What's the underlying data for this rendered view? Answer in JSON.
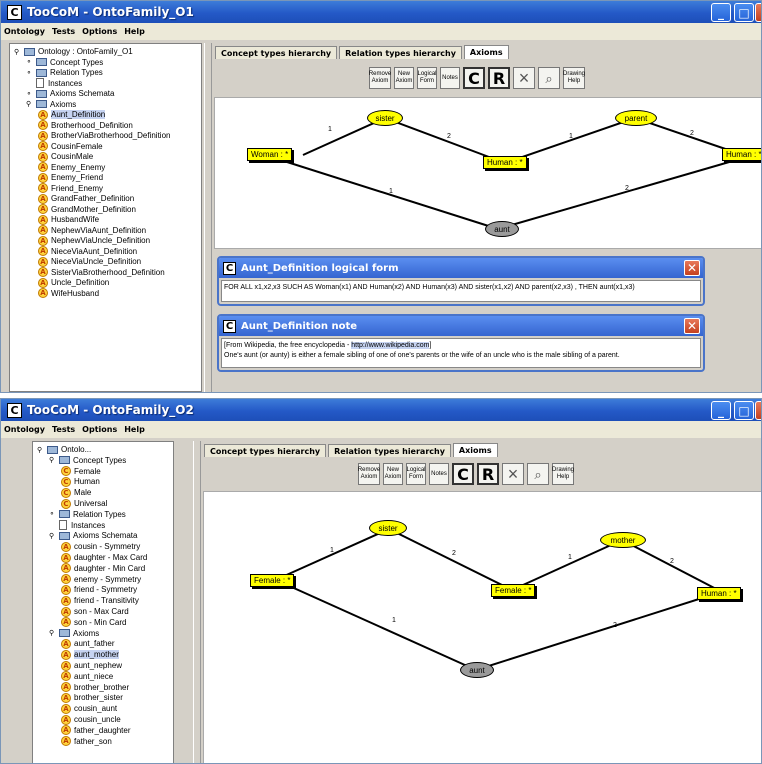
{
  "window1": {
    "title": "TooCoM - OntoFamily_O1",
    "menu": [
      "Ontology",
      "Tests",
      "Options",
      "Help"
    ],
    "tree": [
      {
        "label": "Ontology : OntoFamily_O1",
        "kind": "folder",
        "depth": 0,
        "expanded": true
      },
      {
        "label": "Concept Types",
        "kind": "folder",
        "depth": 1,
        "expanded": false
      },
      {
        "label": "Relation Types",
        "kind": "folder",
        "depth": 1,
        "expanded": false
      },
      {
        "label": "Instances",
        "kind": "doc",
        "depth": 1
      },
      {
        "label": "Axioms Schemata",
        "kind": "folder",
        "depth": 1,
        "expanded": false
      },
      {
        "label": "Axioms",
        "kind": "folder",
        "depth": 1,
        "expanded": true
      },
      {
        "label": "Aunt_Definition",
        "kind": "axiom",
        "depth": 2,
        "selected": true
      },
      {
        "label": "Brotherhood_Definition",
        "kind": "axiom",
        "depth": 2
      },
      {
        "label": "BrotherViaBrotherhood_Definition",
        "kind": "axiom",
        "depth": 2
      },
      {
        "label": "CousinFemale",
        "kind": "axiom",
        "depth": 2
      },
      {
        "label": "CousinMale",
        "kind": "axiom",
        "depth": 2
      },
      {
        "label": "Enemy_Enemy",
        "kind": "axiom",
        "depth": 2
      },
      {
        "label": "Enemy_Friend",
        "kind": "axiom",
        "depth": 2
      },
      {
        "label": "Friend_Enemy",
        "kind": "axiom",
        "depth": 2
      },
      {
        "label": "GrandFather_Definition",
        "kind": "axiom",
        "depth": 2
      },
      {
        "label": "GrandMother_Definition",
        "kind": "axiom",
        "depth": 2
      },
      {
        "label": "HusbandWife",
        "kind": "axiom",
        "depth": 2
      },
      {
        "label": "NephewViaAunt_Definition",
        "kind": "axiom",
        "depth": 2
      },
      {
        "label": "NephewViaUncle_Definition",
        "kind": "axiom",
        "depth": 2
      },
      {
        "label": "NieceViaAunt_Definition",
        "kind": "axiom",
        "depth": 2
      },
      {
        "label": "NieceViaUncle_Definition",
        "kind": "axiom",
        "depth": 2
      },
      {
        "label": "SisterViaBrotherhood_Definition",
        "kind": "axiom",
        "depth": 2
      },
      {
        "label": "Uncle_Definition",
        "kind": "axiom",
        "depth": 2
      },
      {
        "label": "WifeHusband",
        "kind": "axiom",
        "depth": 2
      }
    ],
    "tabs": [
      "Concept types hierarchy",
      "Relation types hierarchy",
      "Axioms"
    ],
    "toolbar": [
      "Remove Axiom",
      "New Axiom",
      "Logical Form",
      "Notes",
      "C",
      "R",
      "×",
      "select",
      "Drawing Help"
    ],
    "graph": {
      "concepts": [
        "Woman : *",
        "Human : *",
        "Human : *"
      ],
      "relations": [
        "sister",
        "parent",
        "aunt"
      ],
      "edge_labels": [
        "1",
        "2",
        "1",
        "2",
        "1",
        "2"
      ]
    },
    "logical_form": {
      "title": "Aunt_Definition logical form",
      "text": "FOR ALL x1,x2,x3 SUCH AS Woman(x1) AND Human(x2) AND Human(x3) AND sister(x1,x2) AND parent(x2,x3)  , THEN aunt(x1,x3)"
    },
    "note": {
      "title": "Aunt_Definition note",
      "line1_prefix": "[From Wikipedia, the free encyclopedia - ",
      "line1_link": "http://www.wikipedia.com",
      "line1_suffix": "]",
      "line2": "One's aunt (or aunty) is either a female sibling of one of one's parents or the wife of an uncle who is the male sibling of a parent."
    }
  },
  "window2": {
    "title": "TooCoM - OntoFamily_O2",
    "menu": [
      "Ontology",
      "Tests",
      "Options",
      "Help"
    ],
    "tree": [
      {
        "label": "Ontolo...",
        "kind": "folder",
        "depth": 0,
        "expanded": true
      },
      {
        "label": "Concept Types",
        "kind": "folder",
        "depth": 1,
        "expanded": true
      },
      {
        "label": "Female",
        "kind": "concept",
        "depth": 2
      },
      {
        "label": "Human",
        "kind": "concept",
        "depth": 2
      },
      {
        "label": "Male",
        "kind": "concept",
        "depth": 2
      },
      {
        "label": "Universal",
        "kind": "concept",
        "depth": 2
      },
      {
        "label": "Relation Types",
        "kind": "folder",
        "depth": 1,
        "expanded": false
      },
      {
        "label": "Instances",
        "kind": "doc",
        "depth": 1
      },
      {
        "label": "Axioms Schemata",
        "kind": "folder",
        "depth": 1,
        "expanded": true
      },
      {
        "label": "cousin - Symmetry",
        "kind": "axiom",
        "depth": 2
      },
      {
        "label": "daughter - Max Card",
        "kind": "axiom",
        "depth": 2
      },
      {
        "label": "daughter - Min Card",
        "kind": "axiom",
        "depth": 2
      },
      {
        "label": "enemy - Symmetry",
        "kind": "axiom",
        "depth": 2
      },
      {
        "label": "friend - Symmetry",
        "kind": "axiom",
        "depth": 2
      },
      {
        "label": "friend - Transitivity",
        "kind": "axiom",
        "depth": 2
      },
      {
        "label": "son - Max Card",
        "kind": "axiom",
        "depth": 2
      },
      {
        "label": "son - Min Card",
        "kind": "axiom",
        "depth": 2
      },
      {
        "label": "Axioms",
        "kind": "folder",
        "depth": 1,
        "expanded": true
      },
      {
        "label": "aunt_father",
        "kind": "axiom",
        "depth": 2
      },
      {
        "label": "aunt_mother",
        "kind": "axiom",
        "depth": 2,
        "selected": true
      },
      {
        "label": "aunt_nephew",
        "kind": "axiom",
        "depth": 2
      },
      {
        "label": "aunt_niece",
        "kind": "axiom",
        "depth": 2
      },
      {
        "label": "brother_brother",
        "kind": "axiom",
        "depth": 2
      },
      {
        "label": "brother_sister",
        "kind": "axiom",
        "depth": 2
      },
      {
        "label": "cousin_aunt",
        "kind": "axiom",
        "depth": 2
      },
      {
        "label": "cousin_uncle",
        "kind": "axiom",
        "depth": 2
      },
      {
        "label": "father_daughter",
        "kind": "axiom",
        "depth": 2
      },
      {
        "label": "father_son",
        "kind": "axiom",
        "depth": 2
      }
    ],
    "tabs": [
      "Concept types hierarchy",
      "Relation types hierarchy",
      "Axioms"
    ],
    "toolbar": [
      "Remove Axiom",
      "New Axiom",
      "Logical Form",
      "Notes",
      "C",
      "R",
      "×",
      "select",
      "Drawing Help"
    ],
    "graph": {
      "concepts": [
        "Female : *",
        "Female : *",
        "Human : *"
      ],
      "relations": [
        "sister",
        "mother",
        "aunt"
      ],
      "edge_labels": [
        "1",
        "2",
        "1",
        "2",
        "1",
        "2"
      ]
    }
  }
}
